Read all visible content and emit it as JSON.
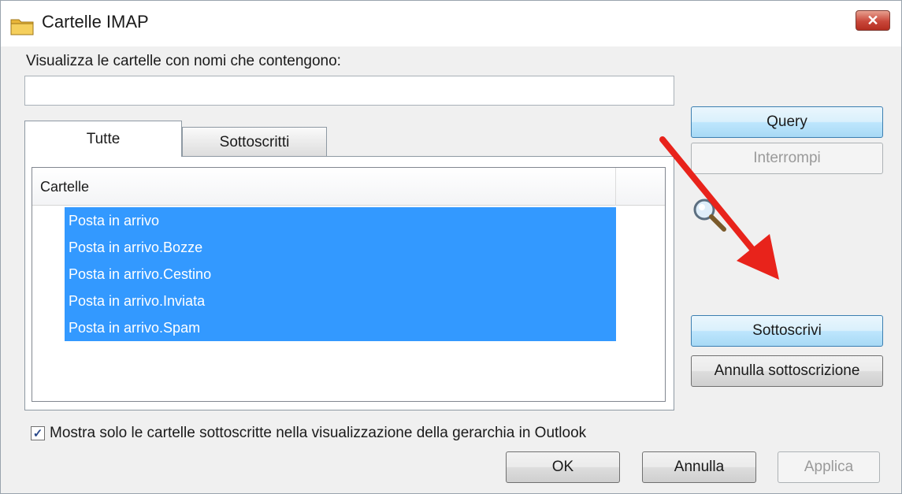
{
  "window": {
    "title": "Cartelle IMAP",
    "close_label": "✕"
  },
  "filter": {
    "label": "Visualizza le cartelle con nomi che contengono:",
    "value": "",
    "placeholder": ""
  },
  "tabs": [
    {
      "label": "Tutte",
      "active": true
    },
    {
      "label": "Sottoscritti",
      "active": false
    }
  ],
  "list": {
    "column_header": "Cartelle",
    "rows": [
      "Posta in arrivo",
      "Posta in arrivo.Bozze",
      "Posta in arrivo.Cestino",
      "Posta in arrivo.Inviata",
      "Posta in arrivo.Spam"
    ]
  },
  "buttons": {
    "query": "Query",
    "stop": "Interrompi",
    "subscribe": "Sottoscrivi",
    "unsubscribe": "Annulla sottoscrizione",
    "ok": "OK",
    "cancel": "Annulla",
    "apply": "Applica"
  },
  "checkbox": {
    "checked": true,
    "mark": "✓",
    "label": "Mostra solo le cartelle sottoscritte nella visualizzazione della gerarchia in Outlook"
  },
  "icons": {
    "title": "folder-icon",
    "search": "magnifier-icon",
    "annotation": "red-arrow-icon"
  },
  "colors": {
    "selection": "#3399ff",
    "arrow": "#e8231b",
    "close": "#c9473a"
  }
}
